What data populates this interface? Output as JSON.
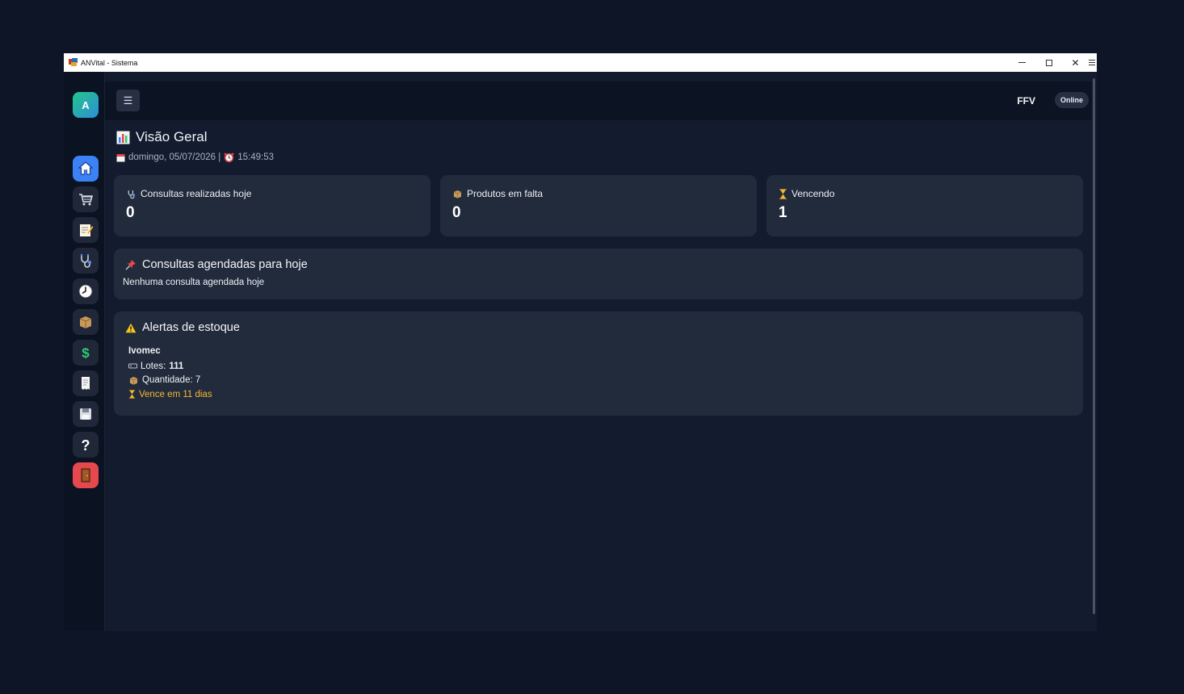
{
  "window": {
    "title": "ANVital - Sistema"
  },
  "sidebar": {
    "logo_letter": "A",
    "items": [
      {
        "name": "home-icon",
        "active": true
      },
      {
        "name": "cart-icon"
      },
      {
        "name": "notes-icon"
      },
      {
        "name": "stethoscope-icon"
      },
      {
        "name": "clock-icon"
      },
      {
        "name": "box-icon"
      },
      {
        "name": "dollar-icon"
      },
      {
        "name": "receipt-icon"
      },
      {
        "name": "save-icon"
      },
      {
        "name": "help-icon"
      },
      {
        "name": "door-icon",
        "danger": true
      }
    ]
  },
  "topbar": {
    "menu_glyph": "☰",
    "user": "FFV",
    "status": "Online"
  },
  "page": {
    "title": "Visão Geral",
    "date": "domingo, 05/07/2026 |",
    "time": "15:49:53"
  },
  "stats": [
    {
      "label": "Consultas realizadas hoje",
      "value": "0",
      "icon": "stethoscope-icon"
    },
    {
      "label": "Produtos em falta",
      "value": "0",
      "icon": "box-icon"
    },
    {
      "label": "Vencendo",
      "value": "1",
      "icon": "hourglass-icon"
    }
  ],
  "scheduled": {
    "title": "Consultas agendadas para hoje",
    "empty_text": "Nenhuma consulta agendada hoje"
  },
  "stock_alerts": {
    "title": "Alertas de estoque",
    "items": [
      {
        "name": "Ivomec",
        "lotes_label": "Lotes:",
        "lotes_value": "111",
        "quantity_text": "Quantidade: 7",
        "expiry_text": "Vence em 11 dias"
      }
    ]
  },
  "colors": {
    "accent": "#3b82f6",
    "danger": "#e5484d",
    "warning": "#f5b935",
    "card": "#222b3c",
    "background": "#131c2e"
  }
}
